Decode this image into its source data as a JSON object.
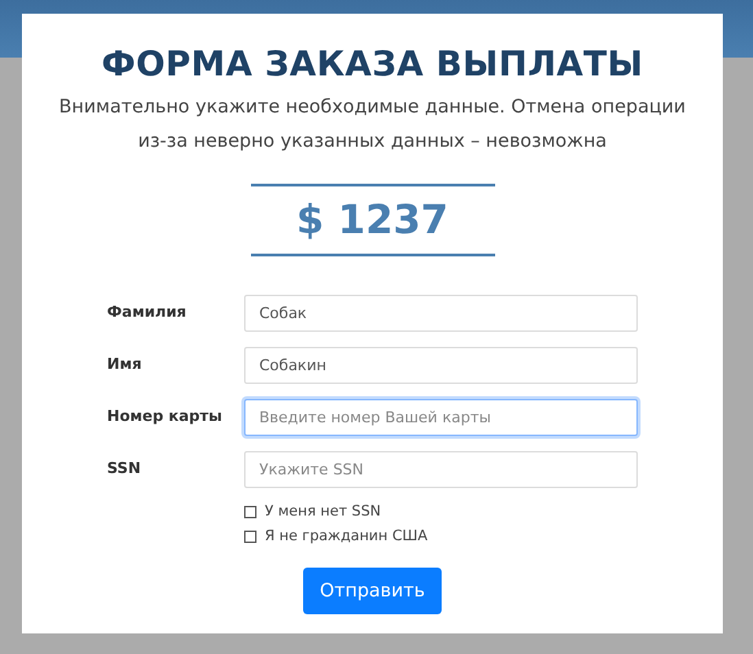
{
  "title": "ФОРМА ЗАКАЗА ВЫПЛАТЫ",
  "subtitle": "Внимательно укажите необходимые данные. Отмена операции из-за неверно указанных данных – невозможна",
  "amount": "$ 1237",
  "fields": [
    {
      "label": "Фамилия",
      "value": "Собак",
      "focused": false
    },
    {
      "label": "Имя",
      "value": "Собакин",
      "focused": false
    },
    {
      "label": "Номер карты",
      "placeholder": "Введите номер Вашей карты",
      "focused": true
    },
    {
      "label": "SSN",
      "placeholder": "Укажите SSN",
      "focused": false
    }
  ],
  "checkboxes": [
    {
      "label": "У меня нет SSN",
      "checked": false
    },
    {
      "label": "Я не гражданин США",
      "checked": false
    }
  ],
  "submit": "Отправить"
}
